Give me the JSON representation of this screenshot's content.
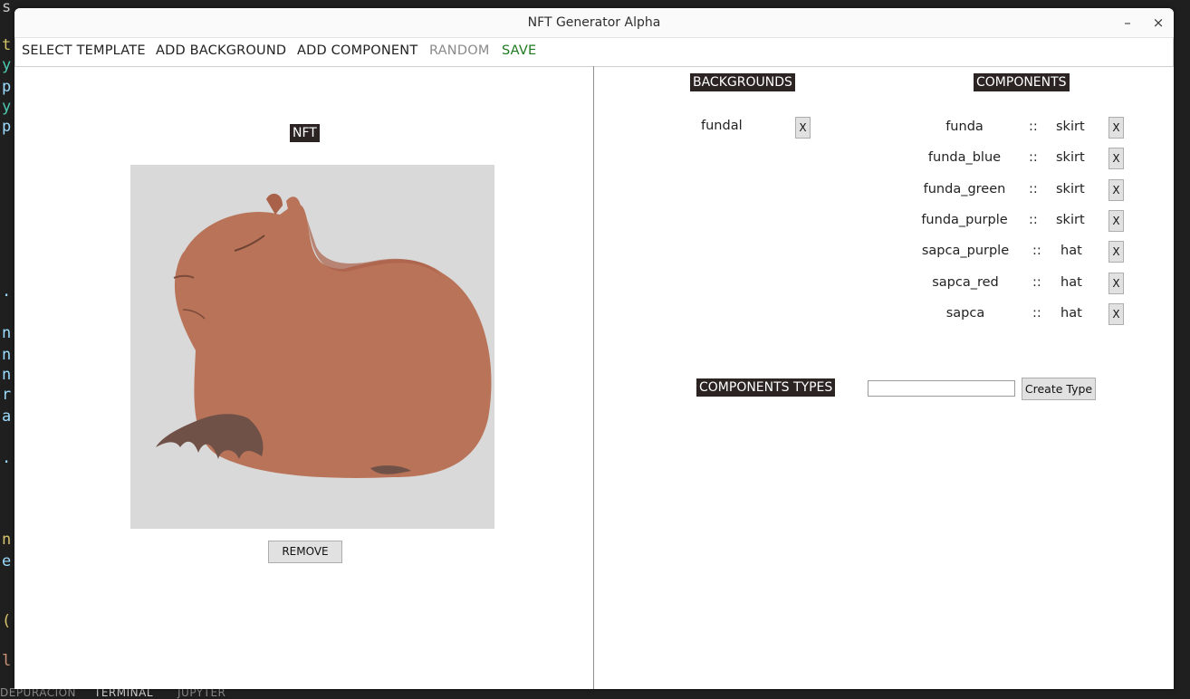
{
  "window": {
    "title": "NFT Generator Alpha",
    "minimize_glyph": "–",
    "close_glyph": "×"
  },
  "menu": {
    "select_template": "SELECT TEMPLATE",
    "add_background": "ADD BACKGROUND",
    "add_component": "ADD COMPONENT",
    "random": "RANDOM",
    "save": "SAVE"
  },
  "colors": {
    "menu_text": "#222222",
    "menu_disabled": "#8a8a8a",
    "menu_save": "#1f7a1f",
    "label_bg": "#2b2423",
    "image_bg": "#d9d9d9",
    "capybara": "#b97358"
  },
  "left_panel": {
    "nft_label": "NFT",
    "remove_button": "REMOVE"
  },
  "backgrounds": {
    "heading": "BACKGROUNDS",
    "items": [
      {
        "name": "fundal",
        "remove": "X"
      }
    ]
  },
  "components": {
    "heading": "COMPONENTS",
    "separator": "::",
    "items": [
      {
        "name": "funda",
        "type": "skirt",
        "remove": "X"
      },
      {
        "name": "funda_blue",
        "type": "skirt",
        "remove": "X"
      },
      {
        "name": "funda_green",
        "type": "skirt",
        "remove": "X"
      },
      {
        "name": "funda_purple",
        "type": "skirt",
        "remove": "X"
      },
      {
        "name": "sapca_purple",
        "type": "hat",
        "remove": "X"
      },
      {
        "name": "sapca_red",
        "type": "hat",
        "remove": "X"
      },
      {
        "name": "sapca",
        "type": "hat",
        "remove": "X"
      }
    ]
  },
  "component_types": {
    "heading": "COMPONENTS TYPES",
    "input_value": "",
    "create_button": "Create Type"
  },
  "editor_background": {
    "bottom_tabs": [
      "DEPURACIÓN",
      "TERMINAL",
      "JUPYTER"
    ]
  }
}
